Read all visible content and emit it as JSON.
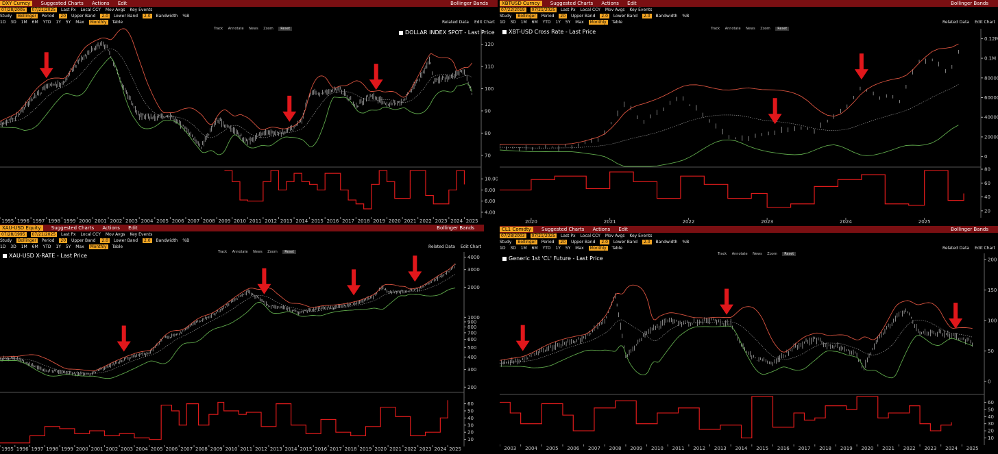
{
  "panels": [
    {
      "ticker": "DXY Curncy",
      "menu": [
        "Suggested Charts",
        "Actions",
        "Edit"
      ],
      "study_title": "Bollinger Bands",
      "legend": "DOLLAR INDEX SPOT - Last Price",
      "dates": [
        "07/28/2005",
        "07/21/2025"
      ],
      "arrows_x": [
        1998,
        2013.7,
        2019.3
      ],
      "ticks_x": [
        "1995",
        "1996",
        "1997",
        "1998",
        "1999",
        "2000",
        "2001",
        "2002",
        "2003",
        "2004",
        "2005",
        "2006",
        "2007",
        "2008",
        "2009",
        "2010",
        "2011",
        "2012",
        "2013",
        "2014",
        "2015",
        "2016",
        "2017",
        "2018",
        "2019",
        "2020",
        "2021",
        "2022",
        "2023",
        "2024",
        "2025"
      ]
    },
    {
      "ticker": "XBTUSD Curncy",
      "menu": [
        "Suggested Charts",
        "Actions",
        "Edit"
      ],
      "study_title": "Bollinger Bands",
      "legend": "XBT-USD Cross Rate - Last Price",
      "dates": [
        "07/22/2019",
        "07/21/2025"
      ],
      "arrows_x": [
        2023.1,
        2024.2
      ],
      "ticks_x": [
        "2020",
        "2021",
        "2022",
        "2023",
        "2024",
        "2025"
      ]
    },
    {
      "ticker": "XAU-USD Equity",
      "menu": [
        "Suggested Charts",
        "Actions",
        "Edit"
      ],
      "study_title": "Bollinger Bands",
      "legend": "XAU-USD X-RATE - Last Price",
      "dates": [
        "07/28/1995",
        "07/21/2025"
      ],
      "arrows_x": [
        2003.3,
        2012.7,
        2018.7,
        2022.8
      ],
      "ticks_x": [
        "1995",
        "1996",
        "1997",
        "1998",
        "1999",
        "2000",
        "2001",
        "2002",
        "2003",
        "2004",
        "2005",
        "2006",
        "2007",
        "2008",
        "2009",
        "2010",
        "2011",
        "2012",
        "2013",
        "2014",
        "2015",
        "2016",
        "2017",
        "2018",
        "2019",
        "2020",
        "2021",
        "2022",
        "2023",
        "2024",
        "2025"
      ]
    },
    {
      "ticker": "CL1 Comdty",
      "menu": [
        "Suggested Charts",
        "Actions",
        "Edit"
      ],
      "study_title": "Bollinger Bands",
      "legend": "Generic 1st 'CL' Future - Last Price",
      "dates": [
        "07/28/2003",
        "07/21/2025"
      ],
      "arrows_x": [
        2004.1,
        2013.8,
        2024.7
      ],
      "ticks_x": [
        "2003",
        "2004",
        "2005",
        "2006",
        "2007",
        "2008",
        "2009",
        "2010",
        "2011",
        "2012",
        "2013",
        "2014",
        "2015",
        "2016",
        "2017",
        "2018",
        "2019",
        "2020",
        "2021",
        "2022",
        "2023",
        "2024",
        "2025",
        "2026"
      ]
    }
  ],
  "toolbar": {
    "row1": [
      "Last Px",
      "Local CCY",
      "Mov Avgs",
      "Key Events"
    ],
    "row2": [
      "Study",
      "Bollinger",
      "Period",
      "20",
      "Upper Band",
      "2.0",
      "Lower Band",
      "2.0",
      "Bandwidth",
      "%B"
    ],
    "row3": [
      "1D",
      "3D",
      "1M",
      "6M",
      "YTD",
      "1Y",
      "5Y",
      "Max",
      "Monthly",
      "Table"
    ],
    "related": "Related Data",
    "edit_chart": "Edit Chart",
    "tools": [
      "Track",
      "Annotate",
      "News",
      "Zoom"
    ],
    "reset": "Reset"
  },
  "chart_data": [
    {
      "type": "line",
      "title": "DOLLAR INDEX SPOT - Last Price",
      "x_range": [
        1995,
        2026
      ],
      "ylim": [
        65,
        127
      ],
      "y_ticks": [
        70,
        80,
        90,
        100,
        110,
        120
      ],
      "series": [
        {
          "name": "DOLLAR INDEX SPOT - Last Price",
          "x": [
            1995,
            1996,
            1997,
            1998,
            1999,
            2000,
            2001,
            2001.5,
            2002,
            2003,
            2004,
            2005,
            2006,
            2007,
            2008,
            2008.5,
            2009,
            2010,
            2011,
            2012,
            2013,
            2014,
            2014.5,
            2015,
            2016,
            2017,
            2018,
            2019,
            2020,
            2021,
            2022,
            2022.8,
            2023,
            2024,
            2025,
            2025.5
          ],
          "values": [
            84,
            87,
            95,
            101,
            102,
            112,
            118,
            120,
            118,
            100,
            88,
            87,
            88,
            82,
            74,
            80,
            86,
            82,
            76,
            80,
            80,
            82,
            86,
            98,
            98,
            100,
            92,
            97,
            93,
            94,
            104,
            113,
            103,
            105,
            108,
            98
          ]
        }
      ],
      "bandwidth": {
        "ylim": [
          3,
          12
        ],
        "y_ticks": [
          4,
          6,
          8,
          10
        ],
        "x": [
          2009.5,
          2010,
          2010.5,
          2011,
          2011.5,
          2012,
          2012.5,
          2013,
          2013.5,
          2014,
          2014.5,
          2015,
          2015.5,
          2016,
          2016.5,
          2017,
          2017.5,
          2018,
          2018.5,
          2019,
          2019.5,
          2020,
          2020.5,
          2021,
          2021.5,
          2022,
          2022.5,
          2023,
          2023.5,
          2024,
          2024.5,
          2025
        ],
        "values": [
          11.5,
          9.5,
          6.2,
          6.0,
          6.0,
          9.5,
          11.5,
          8,
          9.5,
          11,
          9.5,
          9,
          8,
          11,
          11,
          8,
          6.2,
          5.5,
          4.6,
          9,
          11.5,
          9.5,
          6.5,
          6.5,
          11.5,
          11.5,
          7,
          5.5,
          5.5,
          8,
          11.5,
          9
        ]
      }
    },
    {
      "type": "line",
      "title": "XBT-USD Cross Rate - Last Price",
      "x_range": [
        2019.6,
        2025.7
      ],
      "ylim": [
        -10000,
        130000
      ],
      "y_ticks": [
        0,
        20000,
        40000,
        60000,
        80000,
        100000,
        120000
      ],
      "y_tick_labels": [
        "0",
        "20000",
        "40000",
        "60000",
        "80000",
        "0.1M",
        "0.12M"
      ],
      "series": [
        {
          "name": "XBT-USD Cross Rate - Last Price",
          "x": [
            2019.6,
            2020,
            2020.5,
            2020.9,
            2021.2,
            2021.4,
            2021.6,
            2021.9,
            2022.2,
            2022.5,
            2022.8,
            2023,
            2023.3,
            2023.6,
            2023.9,
            2024.2,
            2024.4,
            2024.7,
            2024.9,
            2025.1,
            2025.3,
            2025.5
          ],
          "values": [
            9500,
            8000,
            10000,
            20000,
            55000,
            35000,
            45000,
            62000,
            42000,
            20000,
            19000,
            23000,
            28000,
            27000,
            42000,
            70000,
            62000,
            58000,
            95000,
            100000,
            84000,
            117000
          ]
        }
      ],
      "bandwidth": {
        "ylim": [
          10,
          82
        ],
        "y_ticks": [
          20,
          40,
          60,
          80
        ],
        "x": [
          2019.6,
          2020,
          2020.3,
          2020.7,
          2021,
          2021.3,
          2021.6,
          2021.9,
          2022.2,
          2022.5,
          2022.8,
          2023,
          2023.3,
          2023.6,
          2023.9,
          2024.2,
          2024.5,
          2024.8,
          2025,
          2025.3,
          2025.5
        ],
        "values": [
          50,
          65,
          70,
          52,
          76,
          62,
          38,
          70,
          58,
          38,
          45,
          25,
          30,
          55,
          65,
          72,
          30,
          28,
          78,
          35,
          45
        ]
      }
    },
    {
      "type": "line",
      "title": "XAU-USD X-RATE - Last Price",
      "scale": "log",
      "x_range": [
        1995,
        2026
      ],
      "ylim": [
        180,
        4500
      ],
      "y_ticks": [
        200,
        300,
        400,
        500,
        600,
        700,
        800,
        900,
        1000,
        2000,
        3000,
        4000
      ],
      "series": [
        {
          "name": "XAU-USD X-RATE - Last Price",
          "x": [
            1995,
            1996,
            1997,
            1998,
            1999,
            2000,
            2001,
            2002,
            2003,
            2004,
            2005,
            2006,
            2007,
            2008,
            2009,
            2010,
            2011,
            2011.7,
            2012,
            2013,
            2014,
            2015,
            2016,
            2017,
            2018,
            2019,
            2020,
            2020.6,
            2021,
            2022,
            2023,
            2024,
            2025,
            2025.5
          ],
          "values": [
            385,
            390,
            340,
            290,
            285,
            275,
            270,
            310,
            360,
            410,
            440,
            620,
            680,
            870,
            1000,
            1250,
            1600,
            1820,
            1650,
            1300,
            1250,
            1100,
            1200,
            1250,
            1300,
            1400,
            1600,
            2000,
            1800,
            1800,
            1900,
            2300,
            2800,
            3350
          ]
        }
      ],
      "bandwidth": {
        "ylim": [
          0,
          75
        ],
        "y_ticks": [
          10,
          20,
          30,
          40,
          50,
          60
        ],
        "x": [
          1995,
          1996,
          1997,
          1998,
          1999,
          2000,
          2001,
          2002,
          2003,
          2004,
          2005,
          2005.8,
          2006.5,
          2007,
          2007.5,
          2008.3,
          2009,
          2009.6,
          2010,
          2011,
          2011.5,
          2012.5,
          2013.5,
          2014.5,
          2015.5,
          2016.5,
          2017.5,
          2018.5,
          2019.5,
          2020.5,
          2021.5,
          2022.5,
          2023.5,
          2024.5,
          2025
        ],
        "values": [
          5,
          5,
          15,
          28,
          25,
          18,
          22,
          15,
          18,
          12,
          10,
          58,
          50,
          30,
          60,
          30,
          45,
          62,
          50,
          45,
          48,
          28,
          60,
          30,
          18,
          38,
          20,
          15,
          28,
          55,
          42,
          15,
          20,
          40,
          65
        ]
      }
    },
    {
      "type": "line",
      "title": "Generic 1st 'CL' Future - Last Price",
      "x_range": [
        2003,
        2026
      ],
      "ylim": [
        -20,
        210
      ],
      "y_ticks": [
        0,
        50,
        100,
        150,
        200
      ],
      "series": [
        {
          "name": "Generic 1st 'CL' Future - Last Price",
          "x": [
            2003,
            2004,
            2005,
            2006,
            2007,
            2008,
            2008.5,
            2009,
            2010,
            2011,
            2012,
            2013,
            2014,
            2014.5,
            2015,
            2016,
            2017,
            2018,
            2018.8,
            2019,
            2020,
            2020.3,
            2021,
            2022,
            2022.4,
            2023,
            2024,
            2025,
            2025.5
          ],
          "values": [
            30,
            35,
            50,
            62,
            70,
            100,
            140,
            40,
            80,
            100,
            95,
            100,
            95,
            60,
            40,
            30,
            55,
            70,
            55,
            58,
            45,
            20,
            70,
            110,
            115,
            80,
            80,
            70,
            65
          ]
        }
      ],
      "bandwidth": {
        "ylim": [
          0,
          70
        ],
        "y_ticks": [
          10,
          20,
          30,
          40,
          50,
          60
        ],
        "x": [
          2003,
          2003.5,
          2004,
          2005,
          2006,
          2006.5,
          2007.5,
          2008.5,
          2009.5,
          2010.5,
          2011.5,
          2012.5,
          2013.5,
          2014.5,
          2015,
          2016,
          2017,
          2017.5,
          2018,
          2018.5,
          2019.5,
          2020,
          2021,
          2021.5,
          2022.5,
          2023,
          2023.5,
          2024,
          2024.5
        ],
        "values": [
          60,
          45,
          30,
          58,
          42,
          20,
          52,
          62,
          30,
          45,
          52,
          22,
          28,
          10,
          68,
          25,
          45,
          35,
          38,
          55,
          50,
          68,
          38,
          45,
          55,
          30,
          20,
          28,
          32
        ]
      }
    }
  ]
}
